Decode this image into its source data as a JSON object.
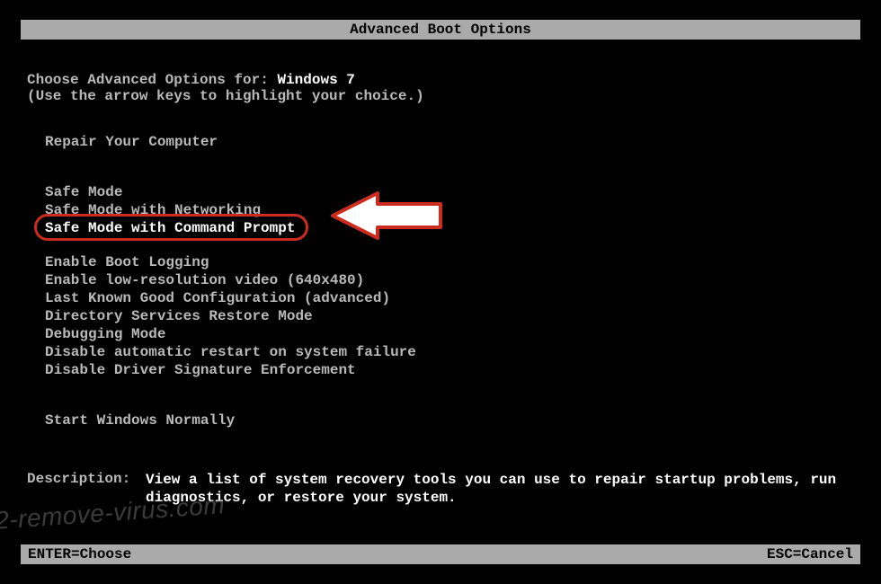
{
  "title": "Advanced Boot Options",
  "intro": {
    "prefix": "Choose Advanced Options for: ",
    "os": "Windows 7",
    "hint": "(Use the arrow keys to highlight your choice.)"
  },
  "groups": [
    {
      "items": [
        "Repair Your Computer"
      ]
    },
    {
      "items": [
        "Safe Mode",
        "Safe Mode with Networking",
        "Safe Mode with Command Prompt"
      ],
      "highlightIndex": 2
    },
    {
      "items": [
        "Enable Boot Logging",
        "Enable low-resolution video (640x480)",
        "Last Known Good Configuration (advanced)",
        "Directory Services Restore Mode",
        "Debugging Mode",
        "Disable automatic restart on system failure",
        "Disable Driver Signature Enforcement"
      ]
    },
    {
      "items": [
        "Start Windows Normally"
      ]
    }
  ],
  "description": {
    "label": "Description:",
    "text": "View a list of system recovery tools you can use to repair startup problems, run diagnostics, or restore your system."
  },
  "footer": {
    "left": "ENTER=Choose",
    "right": "ESC=Cancel"
  },
  "watermark": "2-remove-virus.com"
}
